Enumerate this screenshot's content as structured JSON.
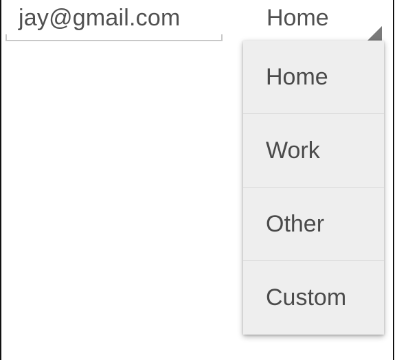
{
  "email": {
    "value": "jay@gmail.com"
  },
  "type_spinner": {
    "selected": "Home"
  },
  "dropdown": {
    "options": [
      "Home",
      "Work",
      "Other",
      "Custom"
    ]
  }
}
